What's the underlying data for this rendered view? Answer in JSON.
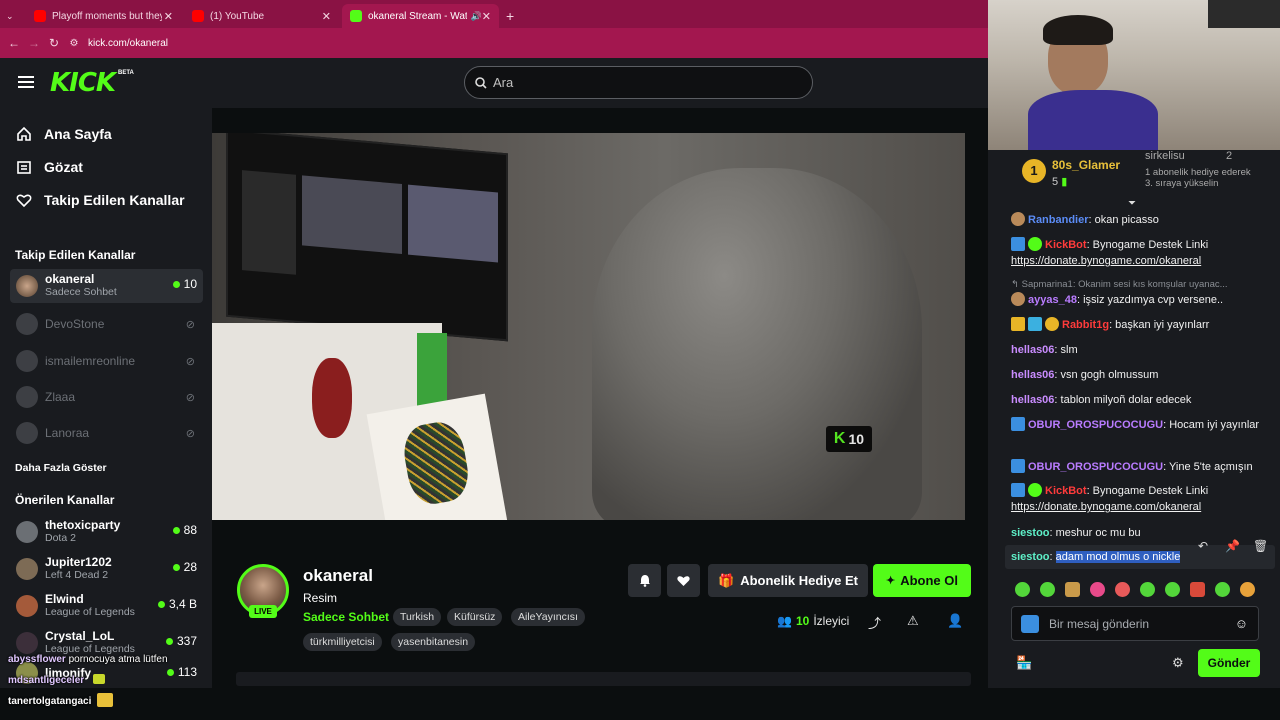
{
  "browser": {
    "tabs": [
      {
        "title": "Playoff moments but they get",
        "icon": "youtube-icon",
        "active": false
      },
      {
        "title": "(1) YouTube",
        "icon": "youtube-icon",
        "active": false
      },
      {
        "title": "okaneral Stream - Watch Li",
        "icon": "kick-icon",
        "active": true
      }
    ],
    "new_tab": "+",
    "url": "kick.com/okaneral"
  },
  "header": {
    "logo": "KICK",
    "logo_badge": "BETA",
    "search_placeholder": "Ara"
  },
  "sidebar": {
    "nav": [
      {
        "label": "Ana Sayfa",
        "icon": "home-icon"
      },
      {
        "label": "Gözat",
        "icon": "browse-icon"
      },
      {
        "label": "Takip Edilen Kanallar",
        "icon": "heart-icon"
      }
    ],
    "followed_title": "Takip Edilen Kanallar",
    "followed": [
      {
        "name": "okaneral",
        "sub": "Sadece Sohbet",
        "count": "10",
        "live": true
      },
      {
        "name": "DevoStone",
        "live": false
      },
      {
        "name": "ismailemreonline",
        "live": false
      },
      {
        "name": "Zlaaa",
        "live": false
      },
      {
        "name": "Lanoraa",
        "live": false
      }
    ],
    "show_more": "Daha Fazla Göster",
    "recommended_title": "Önerilen Kanallar",
    "recommended": [
      {
        "name": "thetoxicparty",
        "sub": "Dota 2",
        "count": "88"
      },
      {
        "name": "Jupiter1202",
        "sub": "Left 4 Dead 2",
        "count": "28"
      },
      {
        "name": "Elwind",
        "sub": "League of Legends",
        "count": "3,4 B"
      },
      {
        "name": "Crystal_LoL",
        "sub": "League of Legends",
        "count": "337"
      },
      {
        "name": "limonify",
        "sub": "",
        "count": "113"
      }
    ]
  },
  "overlay": {
    "lines": [
      {
        "user": "abyssflower",
        "text": "pornocuya atma lütfen"
      },
      {
        "user": "mdsantligeceler",
        "text": ""
      },
      {
        "user": "tanertolgatangaci",
        "text": ""
      }
    ]
  },
  "video": {
    "watermark_count": "10"
  },
  "stream": {
    "name": "okaneral",
    "live_label": "LIVE",
    "title": "Resim",
    "category": "Sadece Sohbet",
    "tags": [
      "Turkish",
      "Küfürsüz",
      "AileYayıncısı",
      "türkmilliyetcisi",
      "yasenbitanesin"
    ],
    "gift_sub_label": "Abonelik Hediye Et",
    "follow_label": "Abone Ol",
    "viewer_count": "10",
    "viewer_label": "İzleyici"
  },
  "chat": {
    "leaderboard": {
      "first_rank": "1",
      "first_name": "80s_Glamer",
      "first_count": "5",
      "second_name": "sirkelisu",
      "second_count": "2",
      "promo": "1 abonelik hediye ederek 3. sıraya yükselin"
    },
    "messages": [
      {
        "user": "Ranbandier",
        "color": "#5b8cf6",
        "text": ": okan picasso"
      },
      {
        "user": "KickBot",
        "color": "#ff3b3b",
        "text": ": Bynogame Destek Linki",
        "link": "https://donate.bynogame.com/okaneral"
      },
      {
        "reply": "Sapmarina1: Okanim sesi kıs komşular uyanac..."
      },
      {
        "user": "ayyas_48",
        "color": "#b97cff",
        "text": ": işsiz yazdımya cvp versene.."
      },
      {
        "user": "Rabbit1g",
        "color": "#ff3b3b",
        "text": ": başkan iyi yayınlarr"
      },
      {
        "user": "hellas06",
        "color": "#c98cff",
        "text": ": slm"
      },
      {
        "user": "hellas06",
        "color": "#c98cff",
        "text": ": vsn gogh olmussum"
      },
      {
        "user": "hellas06",
        "color": "#c98cff",
        "text": ": tablon milyoñ dolar edecek"
      },
      {
        "user": "OBUR_OROSPUCOCUGU",
        "color": "#b97cff",
        "text": ": Hocam iyi yayınlar"
      },
      {
        "user": "OBUR_OROSPUCOCUGU",
        "color": "#b97cff",
        "text": ": Yine 5'te açmışın"
      },
      {
        "user": "KickBot",
        "color": "#ff3b3b",
        "text": ": Bynogame Destek Linki",
        "link": "https://donate.bynogame.com/okaneral"
      },
      {
        "user": "siestoo",
        "color": "#5ef0c8",
        "text": ": meshur oc mu bu"
      },
      {
        "user": "siestoo",
        "color": "#5ef0c8",
        "text": "adam mod olmus o nickle",
        "highlight": true
      }
    ],
    "input_placeholder": "Bir mesaj gönderin",
    "send_label": "Gönder"
  },
  "colors": {
    "accent": "#53fc18",
    "browser_tab": "#8a1244",
    "surface": "#191b1f",
    "background": "#0b0e0f"
  }
}
